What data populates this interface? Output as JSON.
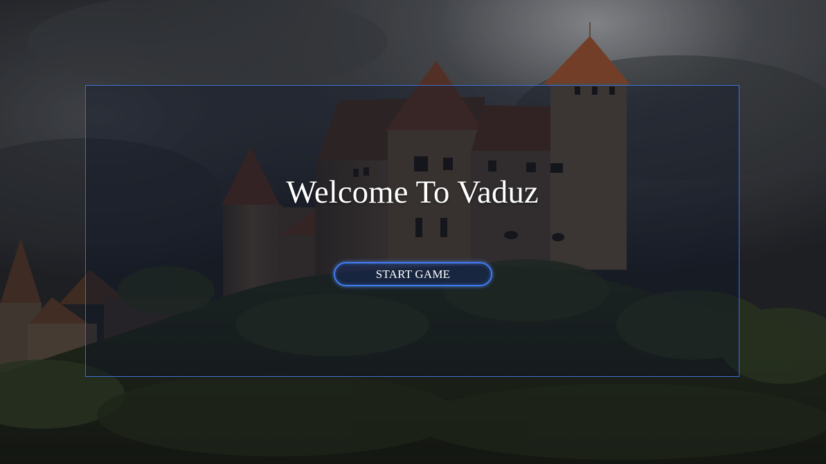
{
  "menu": {
    "title": "Welcome To Vaduz",
    "start_button_label": "START GAME"
  },
  "background": {
    "subject": "castle on a forested hill under a stormy cloudy night sky",
    "palette": {
      "sky": "#2a2d31",
      "cloud_highlight": "#8a8c90",
      "castle_stone": "#5a4a3c",
      "roof": "#6b3f2c",
      "forest": "#1e2418"
    }
  },
  "colors": {
    "accent": "#3f7cf2",
    "text": "#ffffff"
  }
}
